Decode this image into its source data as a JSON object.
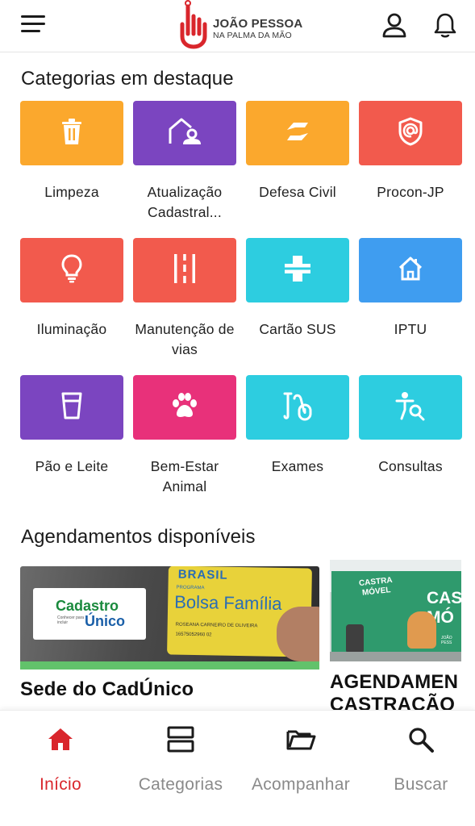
{
  "header": {
    "logo_title": "JOÃO PESSOA",
    "logo_subtitle": "NA PALMA DA MÃO",
    "brand_red": "#d9262c"
  },
  "featured": {
    "title": "Categorias em destaque",
    "categories": [
      {
        "label": "Limpeza",
        "color": "#fba82d",
        "icon": "trash-icon"
      },
      {
        "label": "Atualização Cadastral...",
        "color": "#7b45c0",
        "icon": "home-user-icon"
      },
      {
        "label": "Defesa Civil",
        "color": "#fba82d",
        "icon": "defesa-civil-icon"
      },
      {
        "label": "Procon-JP",
        "color": "#f25a4d",
        "icon": "shield-at-icon"
      },
      {
        "label": "Iluminação",
        "color": "#f25a4d",
        "icon": "lightbulb-icon"
      },
      {
        "label": "Manutenção de vias",
        "color": "#f25a4d",
        "icon": "road-icon"
      },
      {
        "label": "Cartão SUS",
        "color": "#2dcde0",
        "icon": "health-cross-icon"
      },
      {
        "label": "IPTU",
        "color": "#3f9df0",
        "icon": "house-icon"
      },
      {
        "label": "Pão e Leite",
        "color": "#7b45c0",
        "icon": "glass-icon"
      },
      {
        "label": "Bem-Estar Animal",
        "color": "#e8317a",
        "icon": "paw-icon"
      },
      {
        "label": "Exames",
        "color": "#2dcde0",
        "icon": "test-tube-icon"
      },
      {
        "label": "Consultas",
        "color": "#2dcde0",
        "icon": "person-search-icon"
      }
    ]
  },
  "schedules": {
    "title": "Agendamentos disponíveis",
    "cards": [
      {
        "title": "Sede do CadÚnico",
        "logo_line1": "Cadastro",
        "logo_small": "Conhecer para incluir",
        "logo_line2": "Único",
        "card_brand": "BRASIL",
        "card_program_small": "PROGRAMA",
        "card_program": "Bolsa Família",
        "card_holder": "ROSEANA CARNEIRO DE OLIVEIRA",
        "card_number": "16575052960 02",
        "accent": "#62c26b"
      },
      {
        "title": "AGENDAMEN CASTRAÇÃO",
        "truck_text_1": "CASTRA",
        "truck_text_2": "MÓVEL",
        "truck_text_3": "CAS MÓ",
        "truck_text_4": "JOÃO PESS"
      }
    ]
  },
  "bottom_nav": {
    "items": [
      {
        "label": "Início",
        "icon": "home-icon",
        "active": true
      },
      {
        "label": "Categorias",
        "icon": "categories-icon",
        "active": false
      },
      {
        "label": "Acompanhar",
        "icon": "folder-icon",
        "active": false
      },
      {
        "label": "Buscar",
        "icon": "search-icon",
        "active": false
      }
    ],
    "active_color": "#d9262c",
    "inactive_color": "#8a8a8a"
  }
}
